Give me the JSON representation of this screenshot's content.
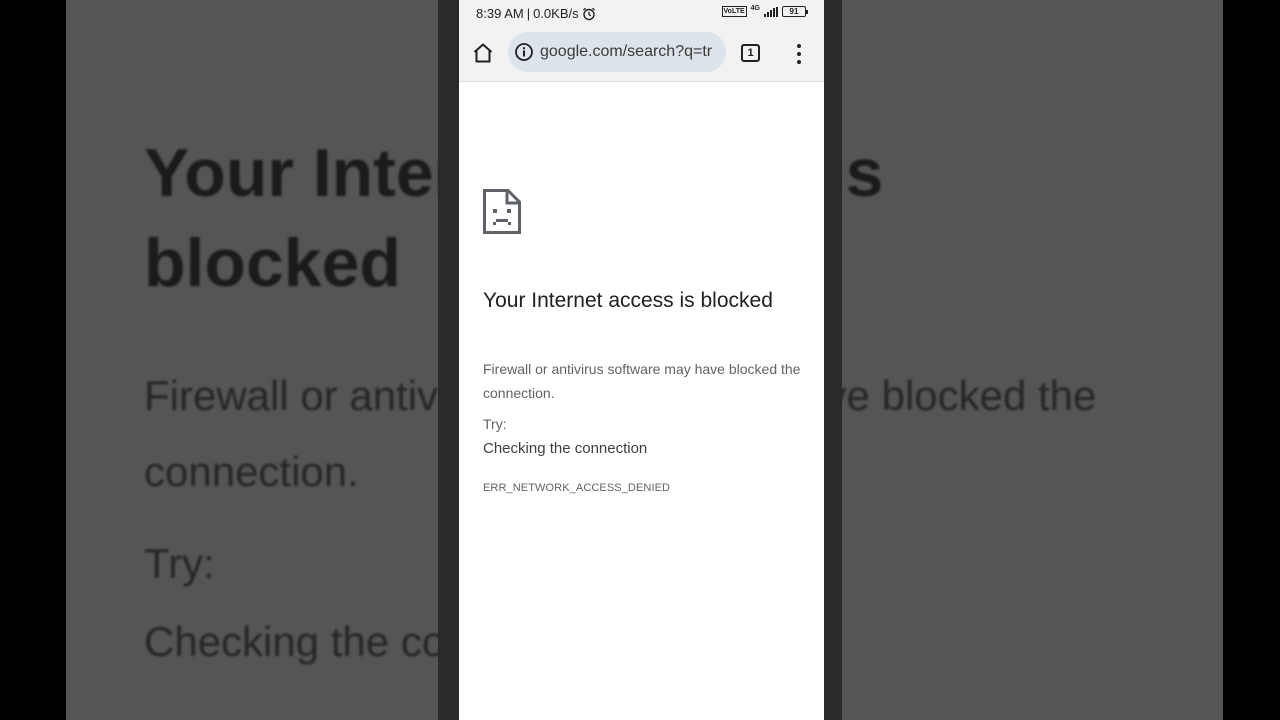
{
  "background": {
    "title": "Your Internet access is blocked",
    "desc": "Firewall or antivirus software may have blocked the connection.",
    "try_label": "Try:",
    "suggestion": "Checking the connection"
  },
  "status_bar": {
    "time": "8:39 AM",
    "separator": "|",
    "speed": "0.0KB/s",
    "alarm_icon": "alarm-icon",
    "volte_label": "VoLTE",
    "network_label": "4G",
    "battery_level": "91"
  },
  "toolbar": {
    "home_icon": "home-icon",
    "info_icon": "info-icon",
    "url": "google.com/search?q=tr",
    "tab_count": "1",
    "menu_icon": "more-vert-icon"
  },
  "error_page": {
    "icon": "sad-page-icon",
    "title": "Your Internet access is blocked",
    "description": "Firewall or antivirus software may have blocked the connection.",
    "try_label": "Try:",
    "suggestions": [
      "Checking the connection"
    ],
    "error_code": "ERR_NETWORK_ACCESS_DENIED"
  },
  "colors": {
    "toolbar_bg": "#f2f2f2",
    "omnibox_bg": "#dde3ea",
    "title_text": "#202124",
    "secondary_text": "#5f6368"
  }
}
